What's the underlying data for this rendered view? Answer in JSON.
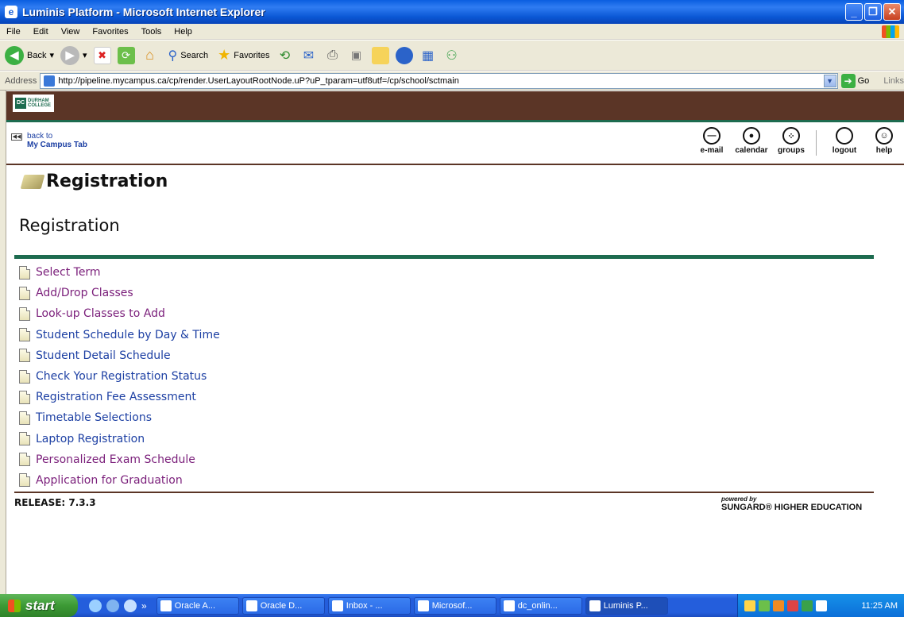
{
  "window": {
    "title": "Luminis Platform - Microsoft Internet Explorer"
  },
  "menu": [
    "File",
    "Edit",
    "View",
    "Favorites",
    "Tools",
    "Help"
  ],
  "toolbar": {
    "back_label": "Back",
    "search_label": "Search",
    "favorites_label": "Favorites"
  },
  "address": {
    "label": "Address",
    "url": "http://pipeline.mycampus.ca/cp/render.UserLayoutRootNode.uP?uP_tparam=utf8utf=/cp/school/sctmain",
    "go_label": "Go",
    "links_label": "Links"
  },
  "brand": {
    "logo_mark": "DC",
    "logo_line1": "DURHAM",
    "logo_line2": "COLLEGE"
  },
  "nav": {
    "back_line1": "back to",
    "back_line2": "My Campus Tab",
    "icons": [
      {
        "label": "e-mail",
        "glyph": "⊖",
        "icon": "email-icon"
      },
      {
        "label": "calendar",
        "glyph": "◉",
        "icon": "calendar-icon"
      },
      {
        "label": "groups",
        "glyph": "⁙",
        "icon": "groups-icon"
      },
      {
        "label": "logout",
        "glyph": "",
        "icon": "logout-icon"
      },
      {
        "label": "help",
        "glyph": "☺",
        "icon": "help-icon"
      }
    ]
  },
  "page": {
    "heading": "Registration",
    "subheading": "Registration",
    "links": [
      {
        "label": "Select Term",
        "color": "#7a1e7a"
      },
      {
        "label": "Add/Drop Classes",
        "color": "#7a1e7a"
      },
      {
        "label": "Look-up Classes to Add",
        "color": "#7a1e7a"
      },
      {
        "label": "Student Schedule by Day & Time",
        "color": "#1c3fa3"
      },
      {
        "label": "Student Detail Schedule",
        "color": "#1c3fa3"
      },
      {
        "label": "Check Your Registration Status",
        "color": "#1c3fa3"
      },
      {
        "label": "Registration Fee Assessment",
        "color": "#1c3fa3"
      },
      {
        "label": "Timetable Selections",
        "color": "#1c3fa3"
      },
      {
        "label": "Laptop Registration",
        "color": "#1c3fa3"
      },
      {
        "label": "Personalized Exam Schedule",
        "color": "#7a1e7a"
      },
      {
        "label": "Application for Graduation",
        "color": "#7a1e7a"
      }
    ],
    "release": "RELEASE: 7.3.3",
    "powered_by": "powered by",
    "sungard": "SUNGARD® HIGHER EDUCATION"
  },
  "taskbar": {
    "start_label": "start",
    "tasks": [
      "Oracle A...",
      "Oracle D...",
      "Inbox - ...",
      "Microsof...",
      "dc_onlin...",
      "Luminis P..."
    ],
    "clock": "11:25 AM"
  }
}
